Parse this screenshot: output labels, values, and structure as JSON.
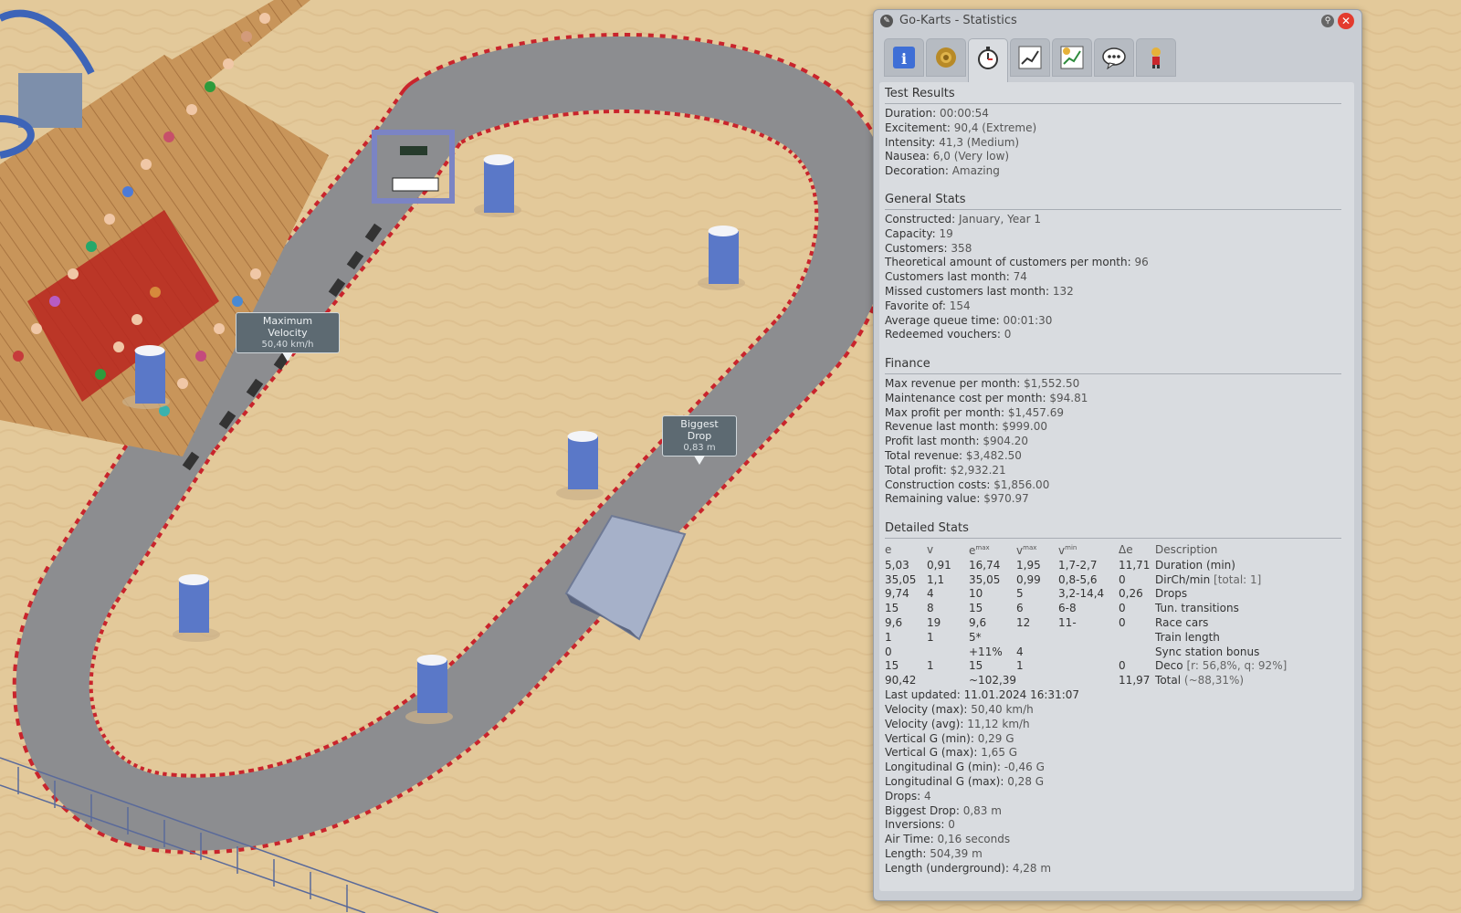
{
  "scene": {
    "labels": {
      "max_velocity": {
        "title": "Maximum Velocity",
        "value": "50,40 km/h"
      },
      "biggest_drop": {
        "title": "Biggest Drop",
        "value": "0,83 m"
      }
    }
  },
  "window": {
    "title": "Go-Karts - Statistics",
    "tabs": [
      {
        "icon": "info-icon"
      },
      {
        "icon": "gear-icon"
      },
      {
        "icon": "stopwatch-icon",
        "active": true
      },
      {
        "icon": "graph-icon"
      },
      {
        "icon": "finance-graph-icon"
      },
      {
        "icon": "speech-bubble-icon"
      },
      {
        "icon": "staff-icon"
      }
    ]
  },
  "test_results": {
    "header": "Test Results",
    "rows": [
      {
        "label": "Duration:",
        "value": "00:00:54"
      },
      {
        "label": "Excitement:",
        "value": "90,4 (Extreme)"
      },
      {
        "label": "Intensity:",
        "value": "41,3 (Medium)"
      },
      {
        "label": "Nausea:",
        "value": "6,0 (Very low)"
      },
      {
        "label": "Decoration:",
        "value": "Amazing"
      }
    ]
  },
  "general_stats": {
    "header": "General Stats",
    "rows": [
      {
        "label": "Constructed:",
        "value": "January, Year 1"
      },
      {
        "label": "Capacity:",
        "value": "19"
      },
      {
        "label": "Customers:",
        "value": "358"
      },
      {
        "label": "Theoretical amount of customers per month:",
        "value": "96"
      },
      {
        "label": "Customers last month:",
        "value": "74"
      },
      {
        "label": "Missed customers last month:",
        "value": "132"
      },
      {
        "label": "Favorite of:",
        "value": "154"
      },
      {
        "label": "Average queue time:",
        "value": "00:01:30"
      },
      {
        "label": "Redeemed vouchers:",
        "value": "0"
      }
    ]
  },
  "finance": {
    "header": "Finance",
    "rows": [
      {
        "label": "Max revenue per month:",
        "value": "$1,552.50"
      },
      {
        "label": "Maintenance cost per month:",
        "value": "$94.81"
      },
      {
        "label": "Max profit per month:",
        "value": "$1,457.69"
      },
      {
        "label": "Revenue last month:",
        "value": "$999.00"
      },
      {
        "label": "Profit last month:",
        "value": "$904.20"
      },
      {
        "label": "Total revenue:",
        "value": "$3,482.50"
      },
      {
        "label": "Total profit:",
        "value": "$2,932.21"
      },
      {
        "label": "Construction costs:",
        "value": "$1,856.00"
      },
      {
        "label": "Remaining value:",
        "value": "$970.97"
      }
    ]
  },
  "detailed_stats": {
    "header": "Detailed Stats",
    "columns": [
      "e",
      "v",
      "e",
      "v",
      "v",
      "Δe",
      "Description"
    ],
    "column_sup": [
      "",
      "",
      "max",
      "max",
      "min",
      "",
      ""
    ],
    "rows": [
      {
        "e": "5,03",
        "v": "0,91",
        "emax": "16,74",
        "vmax": "1,95",
        "vmin": "1,7-2,7",
        "de": "11,71",
        "desc": "Duration (min)",
        "extra": ""
      },
      {
        "e": "35,05",
        "v": "1,1",
        "emax": "35,05",
        "vmax": "0,99",
        "vmin": "0,8-5,6",
        "de": "0",
        "desc": "DirCh/min",
        "extra": "[total: 1]"
      },
      {
        "e": "9,74",
        "v": "4",
        "emax": "10",
        "vmax": "5",
        "vmin": "3,2-14,4",
        "de": "0,26",
        "desc": "Drops",
        "extra": ""
      },
      {
        "e": "15",
        "v": "8",
        "emax": "15",
        "vmax": "6",
        "vmin": "6-8",
        "de": "0",
        "desc": "Tun. transitions",
        "extra": ""
      },
      {
        "e": "9,6",
        "v": "19",
        "emax": "9,6",
        "vmax": "12",
        "vmin": "11-",
        "de": "0",
        "desc": "Race cars",
        "extra": ""
      },
      {
        "e": "1",
        "v": "1",
        "emax": "5*",
        "vmax": "",
        "vmin": "",
        "de": "",
        "desc": "Train length",
        "extra": ""
      },
      {
        "e": "0",
        "v": "",
        "emax": "+11%",
        "vmax": "4",
        "vmin": "",
        "de": "",
        "desc": "Sync station bonus",
        "extra": ""
      },
      {
        "e": "15",
        "v": "1",
        "emax": "15",
        "vmax": "1",
        "vmin": "",
        "de": "0",
        "desc": "Deco",
        "extra": "[r: 56,8%, q: 92%]"
      },
      {
        "e": "90,42",
        "v": "",
        "emax": "~102,39",
        "vmax": "",
        "vmin": "",
        "de": "11,97",
        "desc": "Total",
        "extra": "(~88,31%)"
      }
    ],
    "last_updated": {
      "label": "Last updated:",
      "value": "11.01.2024 16:31:07"
    },
    "rows_after": [
      {
        "label": "Velocity (max):",
        "value": "50,40 km/h"
      },
      {
        "label": "Velocity (avg):",
        "value": "11,12 km/h"
      },
      {
        "label": "Vertical G (min):",
        "value": "0,29 G"
      },
      {
        "label": "Vertical G (max):",
        "value": "1,65 G"
      },
      {
        "label": "Longitudinal G (min):",
        "value": "-0,46 G"
      },
      {
        "label": "Longitudinal G (max):",
        "value": "0,28 G"
      },
      {
        "label": "Drops:",
        "value": "4"
      },
      {
        "label": "Biggest Drop:",
        "value": "0,83 m"
      },
      {
        "label": "Inversions:",
        "value": "0"
      },
      {
        "label": "Air Time:",
        "value": "0,16 seconds"
      },
      {
        "label": "Length:",
        "value": "504,39 m"
      },
      {
        "label": "Length (underground):",
        "value": "4,28 m"
      }
    ]
  }
}
